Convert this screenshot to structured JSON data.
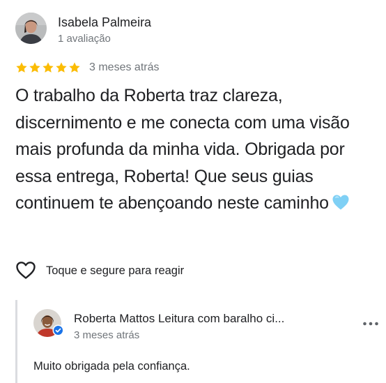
{
  "review": {
    "reviewer_name": "Isabela Palmeira",
    "reviewer_meta": "1 avaliação",
    "rating": 5,
    "rating_max": 5,
    "date": "3 meses atrás",
    "text": "O trabalho da Roberta traz clareza, discernimento e me conecta com uma visão mais profunda da minha vida. Obrigada por essa entrega, Roberta! Que seus guias continuem te abençoando neste caminho",
    "emoji": "light-blue-heart",
    "react_label": "Toque e segure para reagir"
  },
  "reply": {
    "owner_name": "Roberta Mattos Leitura com baralho ci...",
    "date": "3 meses atrás",
    "text": "Muito obrigada pela confiança."
  },
  "icons": {
    "star": "star-icon",
    "react": "heart-outline-icon",
    "verified": "verified-check-icon",
    "more": "more-horizontal-icon"
  },
  "colors": {
    "star": "#fbbc04",
    "secondary_text": "#70757a",
    "primary_text": "#202124",
    "divider": "#dadce0",
    "verified": "#1a73e8",
    "emoji_heart": "#7fd0f5"
  }
}
